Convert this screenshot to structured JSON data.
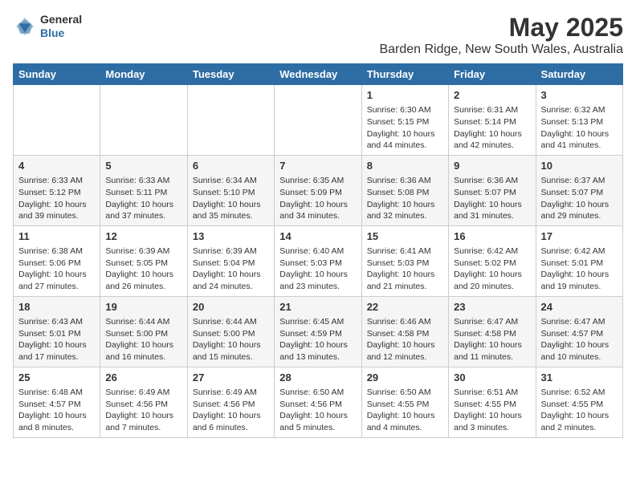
{
  "header": {
    "logo_general": "General",
    "logo_blue": "Blue",
    "title": "May 2025",
    "subtitle": "Barden Ridge, New South Wales, Australia"
  },
  "calendar": {
    "days_of_week": [
      "Sunday",
      "Monday",
      "Tuesday",
      "Wednesday",
      "Thursday",
      "Friday",
      "Saturday"
    ],
    "weeks": [
      [
        {
          "day": "",
          "info": ""
        },
        {
          "day": "",
          "info": ""
        },
        {
          "day": "",
          "info": ""
        },
        {
          "day": "",
          "info": ""
        },
        {
          "day": "1",
          "info": "Sunrise: 6:30 AM\nSunset: 5:15 PM\nDaylight: 10 hours\nand 44 minutes."
        },
        {
          "day": "2",
          "info": "Sunrise: 6:31 AM\nSunset: 5:14 PM\nDaylight: 10 hours\nand 42 minutes."
        },
        {
          "day": "3",
          "info": "Sunrise: 6:32 AM\nSunset: 5:13 PM\nDaylight: 10 hours\nand 41 minutes."
        }
      ],
      [
        {
          "day": "4",
          "info": "Sunrise: 6:33 AM\nSunset: 5:12 PM\nDaylight: 10 hours\nand 39 minutes."
        },
        {
          "day": "5",
          "info": "Sunrise: 6:33 AM\nSunset: 5:11 PM\nDaylight: 10 hours\nand 37 minutes."
        },
        {
          "day": "6",
          "info": "Sunrise: 6:34 AM\nSunset: 5:10 PM\nDaylight: 10 hours\nand 35 minutes."
        },
        {
          "day": "7",
          "info": "Sunrise: 6:35 AM\nSunset: 5:09 PM\nDaylight: 10 hours\nand 34 minutes."
        },
        {
          "day": "8",
          "info": "Sunrise: 6:36 AM\nSunset: 5:08 PM\nDaylight: 10 hours\nand 32 minutes."
        },
        {
          "day": "9",
          "info": "Sunrise: 6:36 AM\nSunset: 5:07 PM\nDaylight: 10 hours\nand 31 minutes."
        },
        {
          "day": "10",
          "info": "Sunrise: 6:37 AM\nSunset: 5:07 PM\nDaylight: 10 hours\nand 29 minutes."
        }
      ],
      [
        {
          "day": "11",
          "info": "Sunrise: 6:38 AM\nSunset: 5:06 PM\nDaylight: 10 hours\nand 27 minutes."
        },
        {
          "day": "12",
          "info": "Sunrise: 6:39 AM\nSunset: 5:05 PM\nDaylight: 10 hours\nand 26 minutes."
        },
        {
          "day": "13",
          "info": "Sunrise: 6:39 AM\nSunset: 5:04 PM\nDaylight: 10 hours\nand 24 minutes."
        },
        {
          "day": "14",
          "info": "Sunrise: 6:40 AM\nSunset: 5:03 PM\nDaylight: 10 hours\nand 23 minutes."
        },
        {
          "day": "15",
          "info": "Sunrise: 6:41 AM\nSunset: 5:03 PM\nDaylight: 10 hours\nand 21 minutes."
        },
        {
          "day": "16",
          "info": "Sunrise: 6:42 AM\nSunset: 5:02 PM\nDaylight: 10 hours\nand 20 minutes."
        },
        {
          "day": "17",
          "info": "Sunrise: 6:42 AM\nSunset: 5:01 PM\nDaylight: 10 hours\nand 19 minutes."
        }
      ],
      [
        {
          "day": "18",
          "info": "Sunrise: 6:43 AM\nSunset: 5:01 PM\nDaylight: 10 hours\nand 17 minutes."
        },
        {
          "day": "19",
          "info": "Sunrise: 6:44 AM\nSunset: 5:00 PM\nDaylight: 10 hours\nand 16 minutes."
        },
        {
          "day": "20",
          "info": "Sunrise: 6:44 AM\nSunset: 5:00 PM\nDaylight: 10 hours\nand 15 minutes."
        },
        {
          "day": "21",
          "info": "Sunrise: 6:45 AM\nSunset: 4:59 PM\nDaylight: 10 hours\nand 13 minutes."
        },
        {
          "day": "22",
          "info": "Sunrise: 6:46 AM\nSunset: 4:58 PM\nDaylight: 10 hours\nand 12 minutes."
        },
        {
          "day": "23",
          "info": "Sunrise: 6:47 AM\nSunset: 4:58 PM\nDaylight: 10 hours\nand 11 minutes."
        },
        {
          "day": "24",
          "info": "Sunrise: 6:47 AM\nSunset: 4:57 PM\nDaylight: 10 hours\nand 10 minutes."
        }
      ],
      [
        {
          "day": "25",
          "info": "Sunrise: 6:48 AM\nSunset: 4:57 PM\nDaylight: 10 hours\nand 8 minutes."
        },
        {
          "day": "26",
          "info": "Sunrise: 6:49 AM\nSunset: 4:56 PM\nDaylight: 10 hours\nand 7 minutes."
        },
        {
          "day": "27",
          "info": "Sunrise: 6:49 AM\nSunset: 4:56 PM\nDaylight: 10 hours\nand 6 minutes."
        },
        {
          "day": "28",
          "info": "Sunrise: 6:50 AM\nSunset: 4:56 PM\nDaylight: 10 hours\nand 5 minutes."
        },
        {
          "day": "29",
          "info": "Sunrise: 6:50 AM\nSunset: 4:55 PM\nDaylight: 10 hours\nand 4 minutes."
        },
        {
          "day": "30",
          "info": "Sunrise: 6:51 AM\nSunset: 4:55 PM\nDaylight: 10 hours\nand 3 minutes."
        },
        {
          "day": "31",
          "info": "Sunrise: 6:52 AM\nSunset: 4:55 PM\nDaylight: 10 hours\nand 2 minutes."
        }
      ]
    ]
  }
}
